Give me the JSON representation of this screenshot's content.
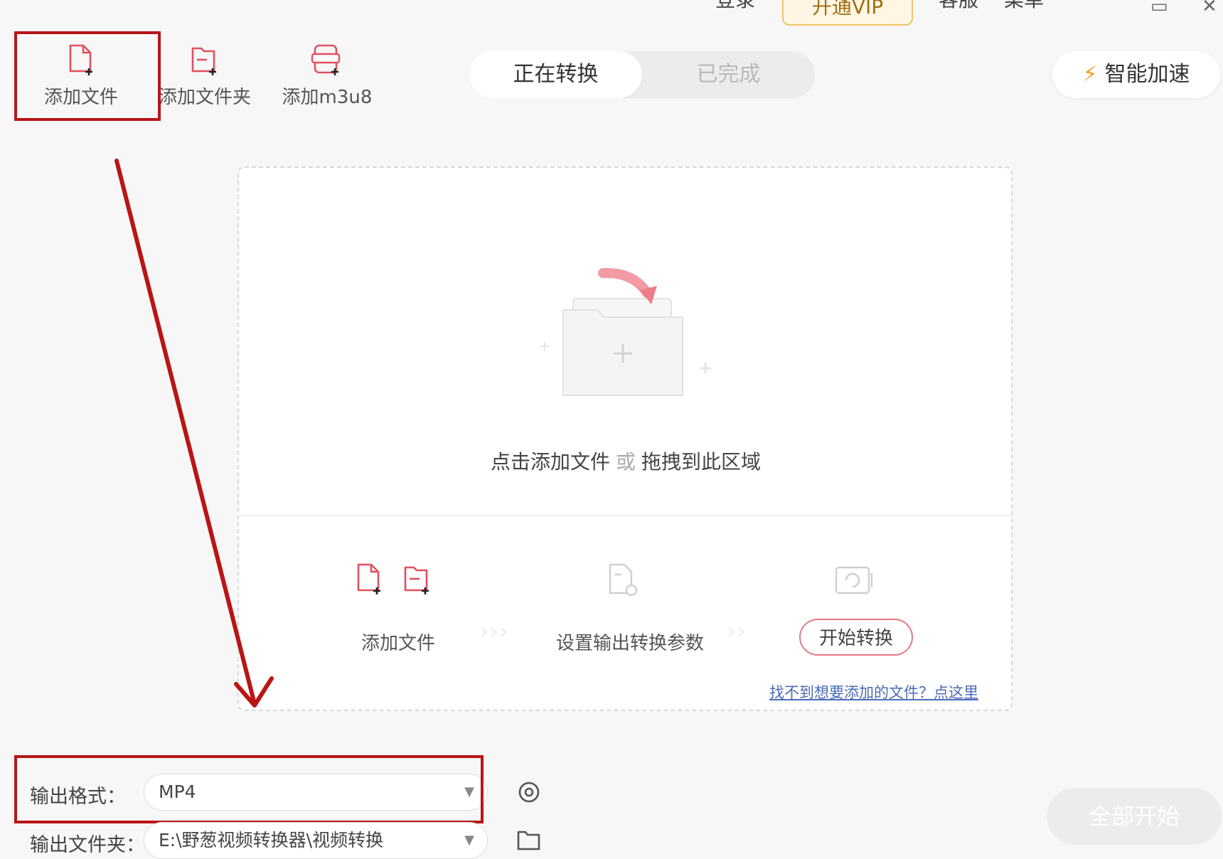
{
  "topbar": {
    "login_label": "登录",
    "vip_label": "开通VIP",
    "service_label": "客服",
    "menu_label": "菜单"
  },
  "toolbar": {
    "add_file_label": "添加文件",
    "add_folder_label": "添加文件夹",
    "add_m3u8_label": "添加m3u8"
  },
  "tabs": {
    "converting_label": "正在转换",
    "completed_label": "已完成"
  },
  "speed_button_label": "智能加速",
  "dropzone": {
    "prompt_click": "点击添加文件",
    "prompt_or": "或",
    "prompt_drag": "拖拽到此区域"
  },
  "steps": {
    "add_file_label": "添加文件",
    "settings_label": "设置输出转换参数",
    "start_label": "开始转换"
  },
  "help_link": "找不到想要添加的文件？点这里",
  "output": {
    "format_label": "输出格式：",
    "format_value": "MP4",
    "folder_label": "输出文件夹：",
    "folder_value": "E:\\野葱视频转换器\\视频转换"
  },
  "all_start_label": "全部开始",
  "colors": {
    "accent": "#e0505f",
    "annotation_red": "#b91515",
    "help_link": "#4a6ab8",
    "bolt": "#f0a020"
  }
}
